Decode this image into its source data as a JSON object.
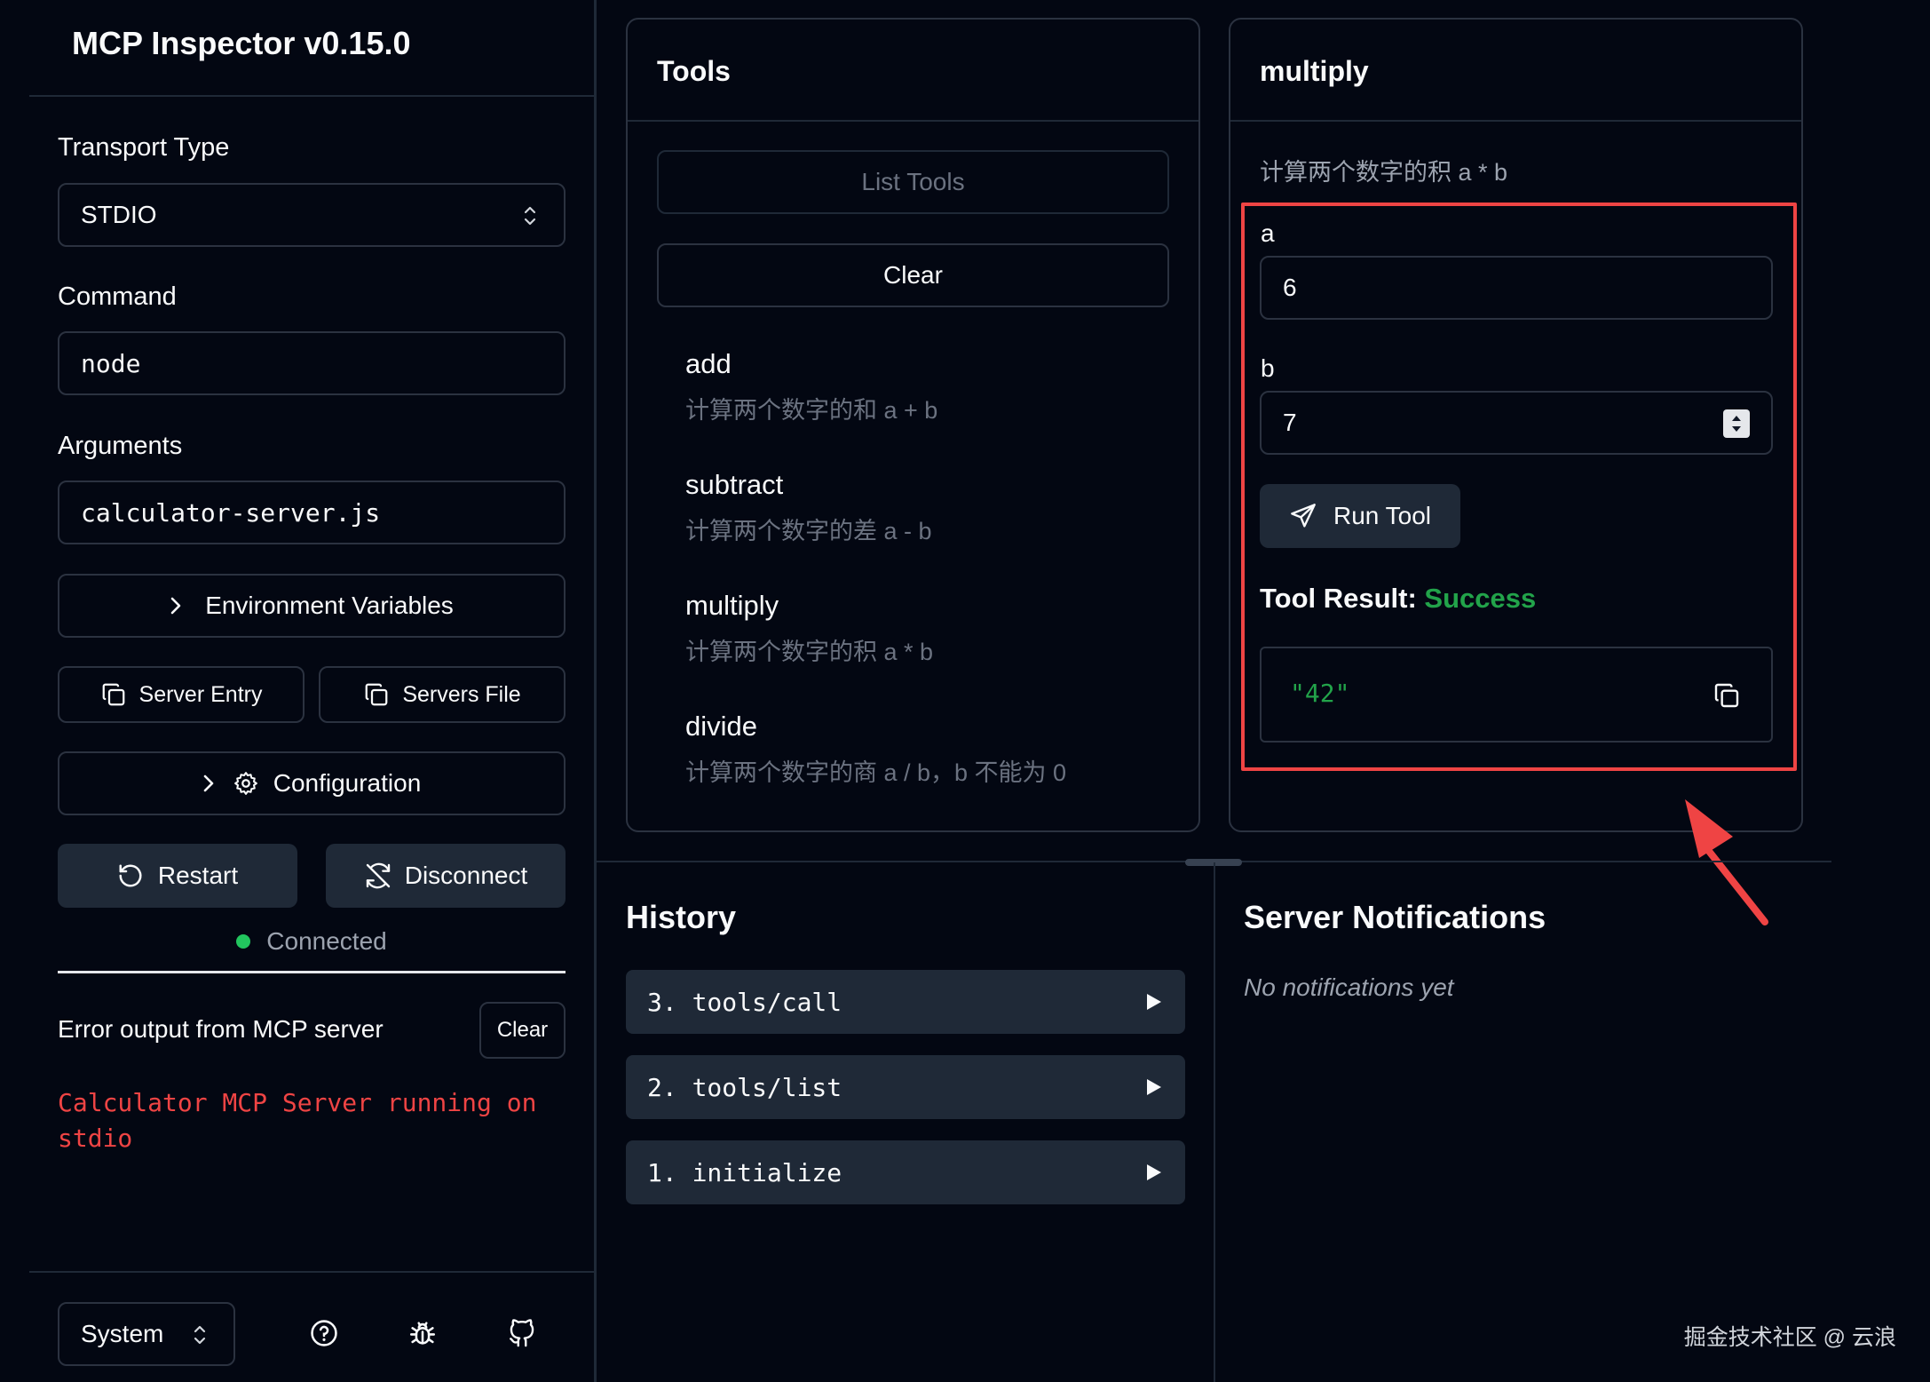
{
  "app": {
    "title": "MCP Inspector v0.15.0"
  },
  "sidebar": {
    "transport_label": "Transport Type",
    "transport_value": "STDIO",
    "command_label": "Command",
    "command_value": "node",
    "arguments_label": "Arguments",
    "arguments_value": "calculator-server.js",
    "env_vars_label": "Environment Variables",
    "server_entry_label": "Server Entry",
    "servers_file_label": "Servers File",
    "configuration_label": "Configuration",
    "restart_label": "Restart",
    "disconnect_label": "Disconnect",
    "status_text": "Connected",
    "status_color": "#22c55e",
    "error_output_label": "Error output from MCP server",
    "error_clear_label": "Clear",
    "error_text": "Calculator MCP Server running on stdio",
    "error_color": "#ef4444",
    "theme_value": "System"
  },
  "tools": {
    "title": "Tools",
    "list_tools_label": "List Tools",
    "clear_label": "Clear",
    "items": [
      {
        "name": "add",
        "description": "计算两个数字的和 a + b"
      },
      {
        "name": "subtract",
        "description": "计算两个数字的差 a - b"
      },
      {
        "name": "multiply",
        "description": "计算两个数字的积 a * b"
      },
      {
        "name": "divide",
        "description": "计算两个数字的商 a / b，b 不能为 0"
      }
    ]
  },
  "tool_detail": {
    "title": "multiply",
    "description": "计算两个数字的积 a * b",
    "param_a_label": "a",
    "param_a_value": "6",
    "param_b_label": "b",
    "param_b_value": "7",
    "run_label": "Run Tool",
    "result_label": "Tool Result:",
    "result_status": "Success",
    "result_color": "#22a34a",
    "result_value": "\"42\"",
    "highlight_color": "#ef4444"
  },
  "history": {
    "title": "History",
    "items": [
      {
        "label": "3. tools/call"
      },
      {
        "label": "2. tools/list"
      },
      {
        "label": "1. initialize"
      }
    ]
  },
  "notifications": {
    "title": "Server Notifications",
    "empty_text": "No notifications yet"
  },
  "watermark": "掘金技术社区 @ 云浪"
}
